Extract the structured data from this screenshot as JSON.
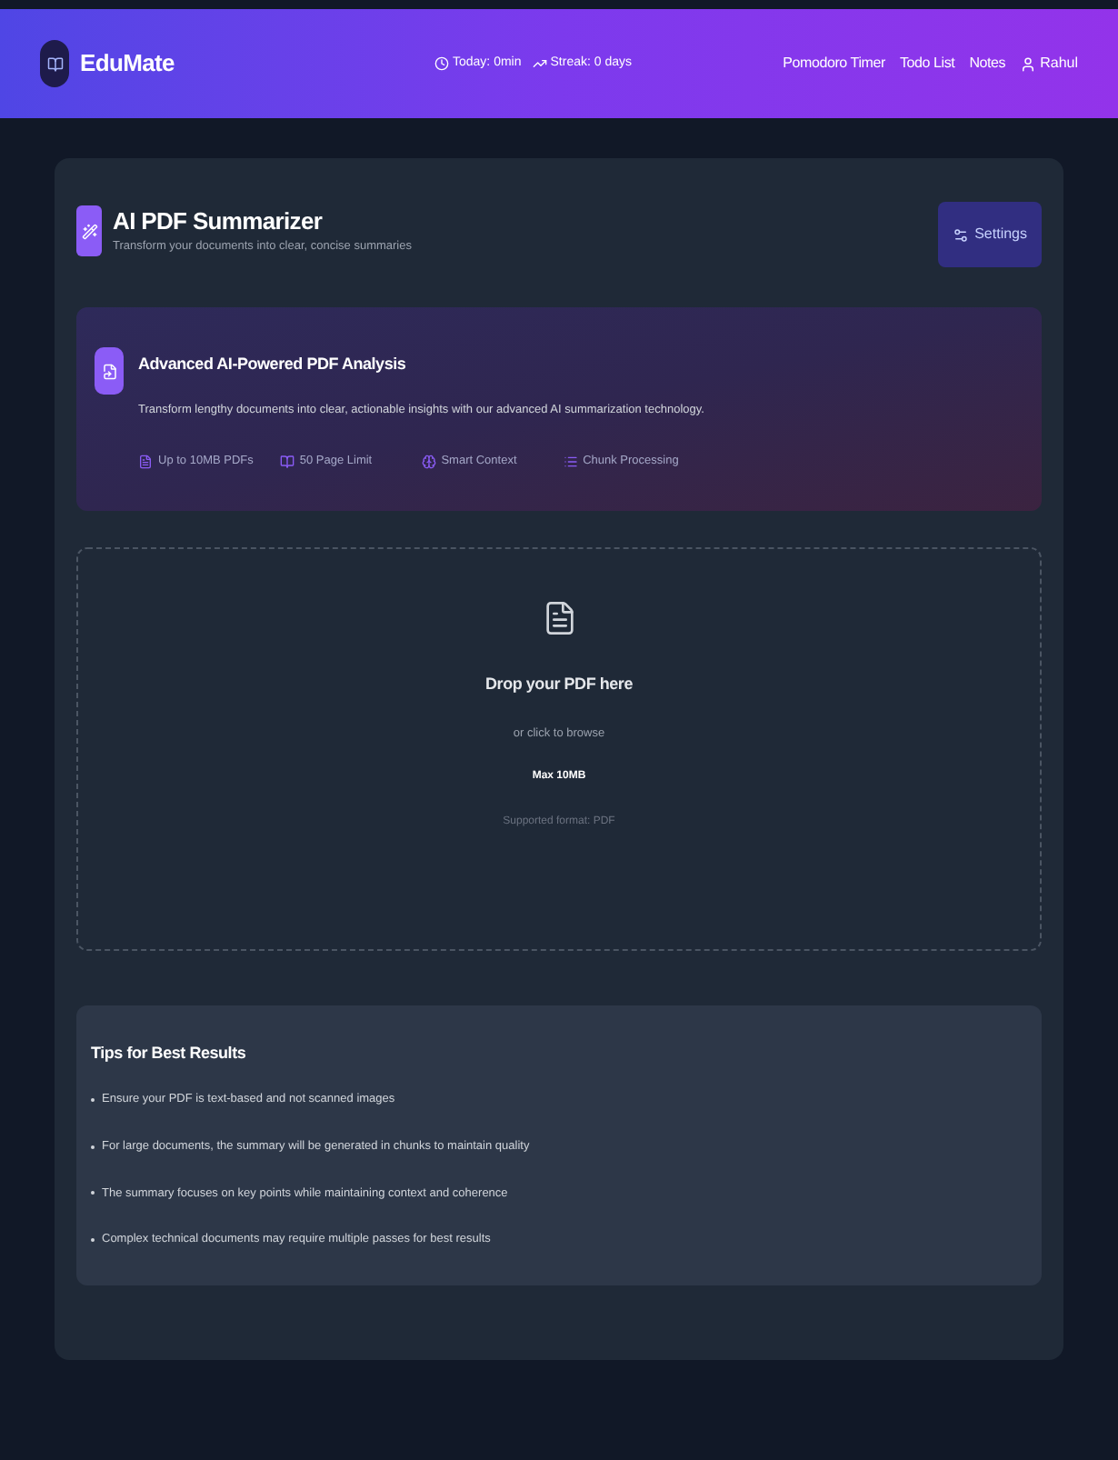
{
  "nav": {
    "brand": "EduMate",
    "stats": [
      {
        "kind": "clock",
        "label": "Today: 0min"
      },
      {
        "kind": "trend",
        "label": "Streak: 0 days"
      }
    ],
    "links": [
      "Pomodoro Timer",
      "Todo List",
      "Notes"
    ],
    "user": "Rahul"
  },
  "header": {
    "title": "AI PDF Summarizer",
    "subtitle": "Transform your documents into clear, concise summaries",
    "settings": "Settings"
  },
  "banner": {
    "title": "Advanced AI-Powered PDF Analysis",
    "description": "Transform lengthy documents into clear, actionable insights with our advanced AI summarization technology.",
    "features": [
      {
        "kind": "file",
        "label": "Up to 10MB PDFs"
      },
      {
        "kind": "book",
        "label": "50 Page Limit"
      },
      {
        "kind": "brain",
        "label": "Smart Context"
      },
      {
        "kind": "list",
        "label": "Chunk Processing"
      }
    ]
  },
  "dropzone": {
    "title": "Drop your PDF here",
    "hint": "or click to browse",
    "max": "Max 10MB",
    "formats": "Supported format: PDF"
  },
  "tips": {
    "title": "Tips for Best Results",
    "items": [
      "Ensure your PDF is text-based and not scanned images",
      "For large documents, the summary will be generated in chunks to maintain quality",
      "The summary focuses on key points while maintaining context and coherence",
      "Complex technical documents may require multiple passes for best results"
    ]
  }
}
